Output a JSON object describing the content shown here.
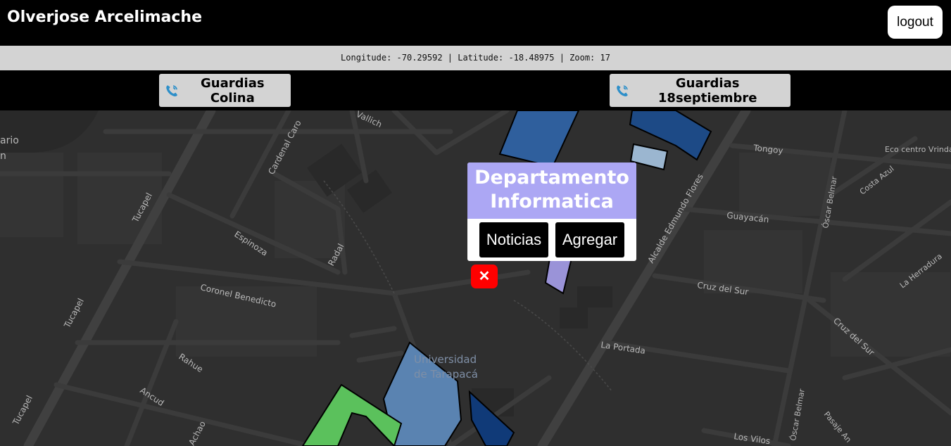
{
  "header": {
    "user_name": "Olverjose Arcelimache",
    "logout_label": "logout"
  },
  "info_bar": {
    "text": "Longitude: -70.29592 | Latitude: -18.48975 | Zoom: 17",
    "longitude": -70.29592,
    "latitude": -18.48975,
    "zoom": 17
  },
  "guard_buttons": [
    {
      "label": "Guardias Colina",
      "icon": "phone-icon"
    },
    {
      "label": "Guardias 18septiembre",
      "icon": "phone-icon"
    }
  ],
  "popup": {
    "title_line1": "Departamento",
    "title_line2": "Informatica",
    "news_label": "Noticias",
    "add_label": "Agregar",
    "close_label": "✕"
  },
  "map": {
    "labels": {
      "tucapel_1": "Tucapel",
      "tucapel_2": "Tucapel",
      "tucapel_3": "Tucapel",
      "cardenal_caro": "Cardenal Caro",
      "vallich": "Vallich",
      "espinoza": "Espinoza",
      "radal": "Radal",
      "coronel_benedicto": "Coronel Benedicto",
      "rahue": "Rahue",
      "ancud": "Ancud",
      "achao": "Achao",
      "universidad_1": "Universidad",
      "universidad_2": "de Tarapacá",
      "tongoy": "Tongoy",
      "eco_centro": "Eco centro Vrinda",
      "costa_azul": "Costa Azul",
      "alcalde": "Alcalde Edmundo Flores",
      "oscar_belmar_1": "Óscar Belmar",
      "oscar_belmar_2": "Óscar Belmar",
      "guayacan": "Guayacán",
      "la_herradura": "La Herradura",
      "cruz_del_sur_1": "Cruz del Sur",
      "cruz_del_sur_2": "Cruz del Sur",
      "la_portada": "La Portada",
      "pasaje_an": "Pasaje An",
      "los_vilos": "Los Vilos",
      "ario": "ario"
    }
  }
}
